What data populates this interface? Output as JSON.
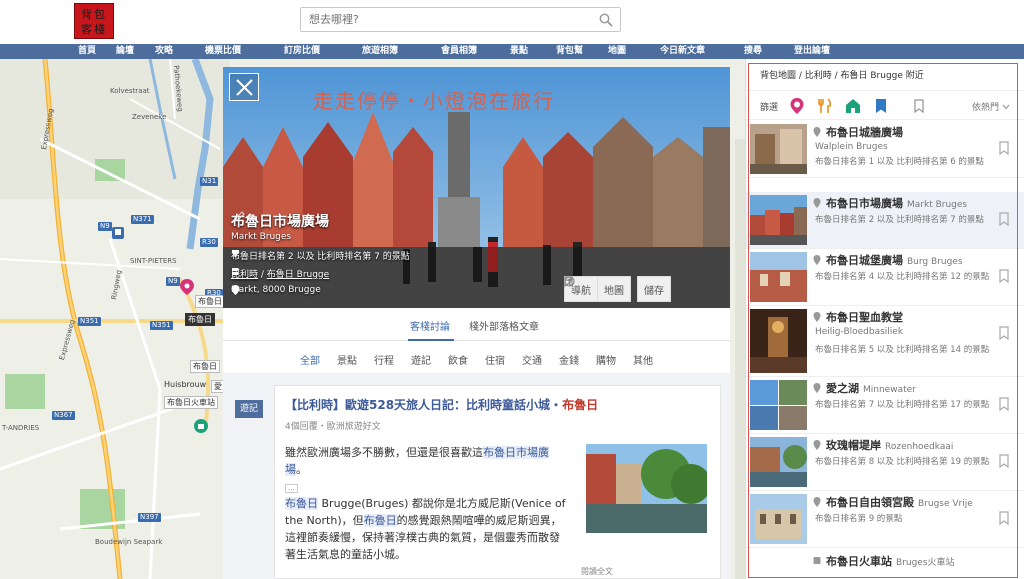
{
  "header": {
    "logo_text": "背包客棧",
    "search_placeholder": "想去哪裡?"
  },
  "nav": {
    "items": [
      "首頁",
      "論壇",
      "攻略",
      "機票比價",
      "訂房比價",
      "旅遊相簿",
      "會員相簿",
      "景點",
      "背包幫",
      "地圖",
      "今日新文章",
      "搜尋",
      "登出論壇"
    ]
  },
  "map": {
    "labels": {
      "kolvestraat": "Kolvestraat",
      "zeveneke": "Zeveneke",
      "expressweg_top": "Expressweg",
      "expressweg_mid": "Expressweg",
      "sint_pieters": "SINT-PIETERS",
      "sint_andries": "T-ANDRIES",
      "boudewijn": "Boudewijn Seapark",
      "huisbrouwerij": "Huisbrouw",
      "pathoekeweg": "Pathoekeweg",
      "ringweg": "Ringweg"
    },
    "shields": {
      "n371": "N371",
      "n9a": "N9",
      "r30a": "R30",
      "n9b": "N9",
      "r30b": "R30",
      "n351a": "N351",
      "n351b": "N351",
      "n367": "N367",
      "n397": "N397",
      "n31": "N31"
    },
    "tags": {
      "t1": "布魯日",
      "t2": "布魯日",
      "t3": "布魯日",
      "t4": "布魯日火車站",
      "t5": "愛"
    }
  },
  "card": {
    "watermark": "走走停停・小燈泡在旅行",
    "title": "布魯日市場廣場",
    "subtitle": "Markt Bruges",
    "rank_line": "布魯日排名第 2 以及 比利時排名第 7 的景點",
    "country_link": "比利時",
    "city_link": "布魯日 Brugge",
    "address": "Markt, 8000 Brugge",
    "btn_nav": "導航",
    "btn_map": "地圖",
    "btn_save": "儲存",
    "tabs": [
      "客棧討論",
      "棧外部落格文章"
    ],
    "categories": [
      "全部",
      "景點",
      "行程",
      "遊記",
      "飲食",
      "住宿",
      "交通",
      "金錢",
      "購物",
      "其他"
    ],
    "post": {
      "badge": "遊記",
      "title_prefix": "【比利時】歐遊528天旅人日記：比利時童話小城・",
      "title_highlight": "布魯日",
      "meta": "4個回覆・歐洲旅遊好文",
      "body_p1_a": "雖然歐洲廣場多不勝數，但還是很喜歡這",
      "body_p1_hl": "布魯日市場廣場",
      "body_p1_b": "。",
      "body_dots": "...",
      "body_p2_hl1": "布魯日",
      "body_p2_a": " Brugge(Bruges) 都說你是北方威尼斯(Venice of the North)，但",
      "body_p2_hl2": "布魯日",
      "body_p2_b": "的感覺跟熱鬧喧嘩的威尼斯迥異，這裡節奏緩慢，保持著淳樸古典的氣質，是個靈秀而散發著生活氣息的童話小城。",
      "more": "閱讀全文"
    }
  },
  "panel": {
    "breadcrumb": "背包地圖 / 比利時 / 布魯日 Brugge 附近",
    "filter_label": "篩選",
    "sort_label": "依熱門",
    "items": [
      {
        "name": "布魯日城牆廣場",
        "en": "",
        "alt": "Walplein Bruges",
        "rank": "布魯日排名第 1 以及 比利時排名第 6 的景點"
      },
      {
        "name": "布魯日市場廣場",
        "en": "Markt Bruges",
        "alt": "",
        "rank": "布魯日排名第 2 以及 比利時排名第 7 的景點"
      },
      {
        "name": "布魯日城堡廣場",
        "en": "Burg Bruges",
        "alt": "",
        "rank": "布魯日排名第 4 以及 比利時排名第 12 的景點"
      },
      {
        "name": "布魯日聖血教堂",
        "en": "",
        "alt": "Heilig-Bloedbasiliek",
        "rank": "布魯日排名第 5 以及 比利時排名第 14 的景點"
      },
      {
        "name": "愛之湖",
        "en": "Minnewater",
        "alt": "",
        "rank": "布魯日排名第 7 以及 比利時排名第 17 的景點"
      },
      {
        "name": "玫瑰帽堤岸",
        "en": "Rozenhoedkaai",
        "alt": "",
        "rank": "布魯日排名第 8 以及 比利時排名第 19 的景點"
      },
      {
        "name": "布魯日自由領宮殿",
        "en": "Brugse Vrije",
        "alt": "",
        "rank": "布魯日排名第 9 的景點"
      },
      {
        "name": "布魯日火車站",
        "en": "Bruges火車站",
        "alt": "",
        "rank": ""
      }
    ]
  },
  "colors": {
    "nav_bg": "#4d6e9c",
    "accent": "#3d6ab0",
    "logo_red": "#c8161d",
    "highlight_red": "#c0392b",
    "panel_border": "#d9534f"
  }
}
